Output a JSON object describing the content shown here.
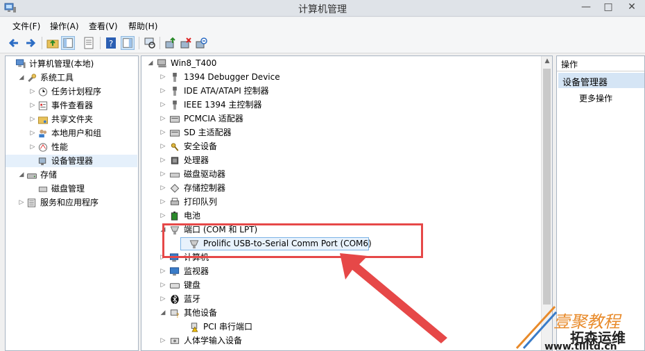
{
  "window": {
    "title": "计算机管理",
    "controls": {
      "minimize": "—",
      "maximize": "□",
      "close": "✕"
    }
  },
  "menu": [
    "文件(F)",
    "操作(A)",
    "查看(V)",
    "帮助(H)"
  ],
  "toolbar": {
    "icons": [
      "back-icon",
      "forward-icon",
      "up-folder-icon",
      "show-tree-icon",
      "properties-icon",
      "help-icon",
      "tree-view-icon",
      "scan-hardware-icon",
      "update-driver-icon",
      "uninstall-icon",
      "disable-icon"
    ]
  },
  "left_tree": [
    {
      "label": "计算机管理(本地)",
      "icon": "computer-management-icon",
      "level": 0,
      "arrow": ""
    },
    {
      "label": "系统工具",
      "icon": "tools-icon",
      "level": 1,
      "arrow": "◢"
    },
    {
      "label": "任务计划程序",
      "icon": "clock-icon",
      "level": 2,
      "arrow": "▷"
    },
    {
      "label": "事件查看器",
      "icon": "event-viewer-icon",
      "level": 2,
      "arrow": "▷"
    },
    {
      "label": "共享文件夹",
      "icon": "shared-folder-icon",
      "level": 2,
      "arrow": "▷"
    },
    {
      "label": "本地用户和组",
      "icon": "users-icon",
      "level": 2,
      "arrow": "▷"
    },
    {
      "label": "性能",
      "icon": "performance-icon",
      "level": 2,
      "arrow": "▷"
    },
    {
      "label": "设备管理器",
      "icon": "device-manager-icon",
      "level": 2,
      "arrow": "",
      "selected": true
    },
    {
      "label": "存储",
      "icon": "storage-icon",
      "level": 1,
      "arrow": "◢"
    },
    {
      "label": "磁盘管理",
      "icon": "disk-management-icon",
      "level": 2,
      "arrow": ""
    },
    {
      "label": "服务和应用程序",
      "icon": "services-icon",
      "level": 1,
      "arrow": "▷"
    }
  ],
  "device_tree": {
    "root": "Win8_T400",
    "items": [
      {
        "label": "1394 Debugger Device",
        "icon": "debugger-icon",
        "arrow": "▷",
        "level": 1
      },
      {
        "label": "IDE ATA/ATAPI 控制器",
        "icon": "ide-controller-icon",
        "arrow": "▷",
        "level": 1
      },
      {
        "label": "IEEE 1394 主控制器",
        "icon": "ieee1394-icon",
        "arrow": "▷",
        "level": 1
      },
      {
        "label": "PCMCIA 适配器",
        "icon": "pcmcia-icon",
        "arrow": "▷",
        "level": 1
      },
      {
        "label": "SD 主适配器",
        "icon": "sd-adapter-icon",
        "arrow": "▷",
        "level": 1
      },
      {
        "label": "安全设备",
        "icon": "security-device-icon",
        "arrow": "▷",
        "level": 1
      },
      {
        "label": "处理器",
        "icon": "processor-icon",
        "arrow": "▷",
        "level": 1
      },
      {
        "label": "磁盘驱动器",
        "icon": "disk-drive-icon",
        "arrow": "▷",
        "level": 1
      },
      {
        "label": "存储控制器",
        "icon": "storage-controller-icon",
        "arrow": "▷",
        "level": 1
      },
      {
        "label": "打印队列",
        "icon": "printer-icon",
        "arrow": "▷",
        "level": 1
      },
      {
        "label": "电池",
        "icon": "battery-icon",
        "arrow": "▷",
        "level": 1
      },
      {
        "label": "端口 (COM 和 LPT)",
        "icon": "port-icon",
        "arrow": "◢",
        "level": 1
      },
      {
        "label": "Prolific USB-to-Serial Comm Port (COM6)",
        "icon": "serial-port-icon",
        "arrow": "",
        "level": 2,
        "selected": true
      },
      {
        "label": "计算机",
        "icon": "computer-icon",
        "arrow": "▷",
        "level": 1
      },
      {
        "label": "监视器",
        "icon": "monitor-icon",
        "arrow": "▷",
        "level": 1
      },
      {
        "label": "键盘",
        "icon": "keyboard-icon",
        "arrow": "▷",
        "level": 1
      },
      {
        "label": "蓝牙",
        "icon": "bluetooth-icon",
        "arrow": "▷",
        "level": 1
      },
      {
        "label": "其他设备",
        "icon": "other-devices-icon",
        "arrow": "◢",
        "level": 1
      },
      {
        "label": "PCI 串行端口",
        "icon": "warning-device-icon",
        "arrow": "",
        "level": 2
      },
      {
        "label": "人体学输入设备",
        "icon": "hid-icon",
        "arrow": "▷",
        "level": 1
      }
    ]
  },
  "actions": {
    "title": "操作",
    "section": "设备管理器",
    "more": "更多操作"
  },
  "watermark": {
    "line1": "壹聚教程",
    "line2": "拓森运维",
    "url": "www.tllltd.cn"
  },
  "colors": {
    "highlight": "#e64848",
    "selection": "#e5f0fb",
    "action_header": "#d5e5f5"
  }
}
